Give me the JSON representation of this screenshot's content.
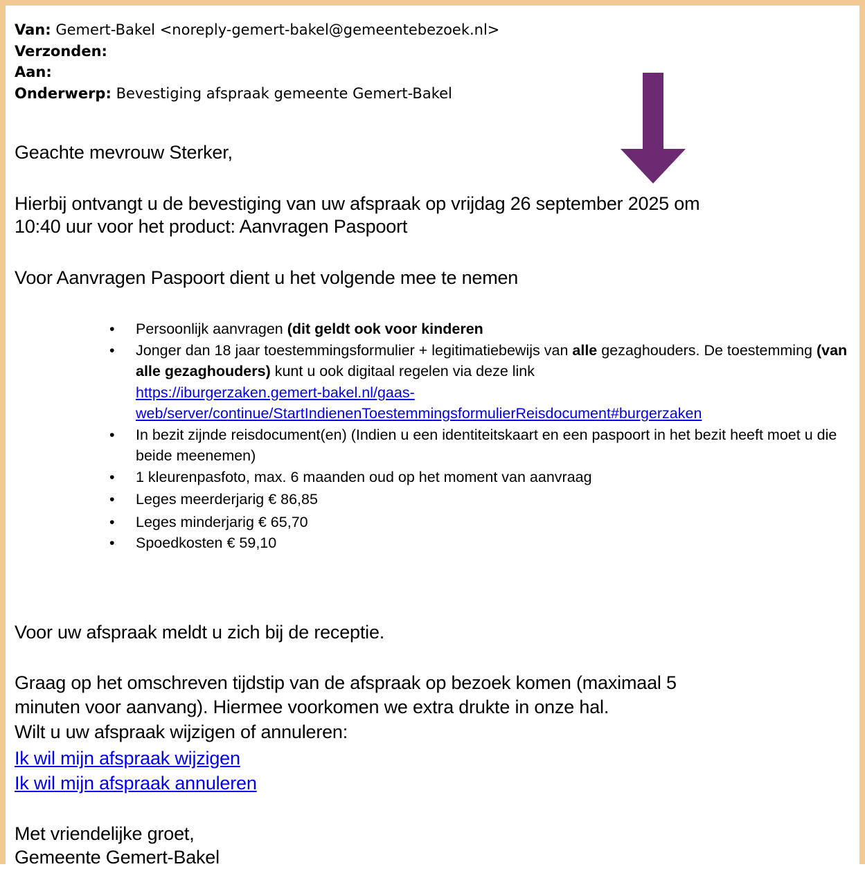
{
  "header": {
    "van_label": "Van:",
    "van_value": "Gemert-Bakel <noreply-gemert-bakel@gemeentebezoek.nl>",
    "verzonden_label": "Verzonden:",
    "aan_label": "Aan:",
    "onderwerp_label": "Onderwerp:",
    "onderwerp_value": "Bevestiging afspraak gemeente Gemert-Bakel"
  },
  "body": {
    "greeting": "Geachte mevrouw Sterker,",
    "confirm_line1": "Hierbij ontvangt u de bevestiging van uw afspraak op vrijdag 26 september 2025 om",
    "confirm_line2": "10:40 uur voor het product: Aanvragen Paspoort",
    "intro": "Voor Aanvragen Paspoort dient u het volgende mee te nemen",
    "items": {
      "i1_a": "Persoonlijk aanvragen ",
      "i1_b": "(dit geldt ook voor kinderen",
      "i2_a": "Jonger dan 18 jaar toestemmingsformulier + legitimatiebewijs  van ",
      "i2_b": "alle",
      "i2_c": " gezaghouders. De toestemming ",
      "i2_d": "(van alle gezaghouders)",
      "i2_e": "  kunt u ook digitaal regelen via deze link",
      "i2_link": "https://iburgerzaken.gemert-bakel.nl/gaas-web/server/continue/StartIndienenToestemmingsformulierReisdocument#burgerzaken",
      "i3": "In bezit zijnde reisdocument(en) (Indien u een identiteitskaart en een paspoort in het bezit heeft moet u die beide meenemen)",
      "i4": "1 kleurenpasfoto, max. 6 maanden oud op het moment van aanvraag",
      "i5": "Leges meerderjarig € 86,85",
      "i6": "Leges minderjarig € 65,70",
      "i7": "Spoedkosten € 59,10"
    },
    "reception": "Voor uw afspraak meldt u zich bij de receptie.",
    "timing_line1": "Graag op het omschreven tijdstip van de afspraak op bezoek komen (maximaal 5",
    "timing_line2": "minuten voor aanvang). Hiermee voorkomen we extra drukte in onze hal.",
    "change_prompt": " Wilt u uw afspraak wijzigen of annuleren:",
    "link_change": "Ik wil mijn afspraak wijzigen",
    "link_cancel": "Ik wil mijn afspraak annuleren",
    "closing": " Met vriendelijke groet,",
    "signature": "Gemeente Gemert-Bakel"
  },
  "colors": {
    "frame": "#f2c993",
    "arrow": "#6b2a72",
    "link": "#0000ee"
  },
  "icons": {
    "annotation_arrow": "down-arrow-icon"
  }
}
